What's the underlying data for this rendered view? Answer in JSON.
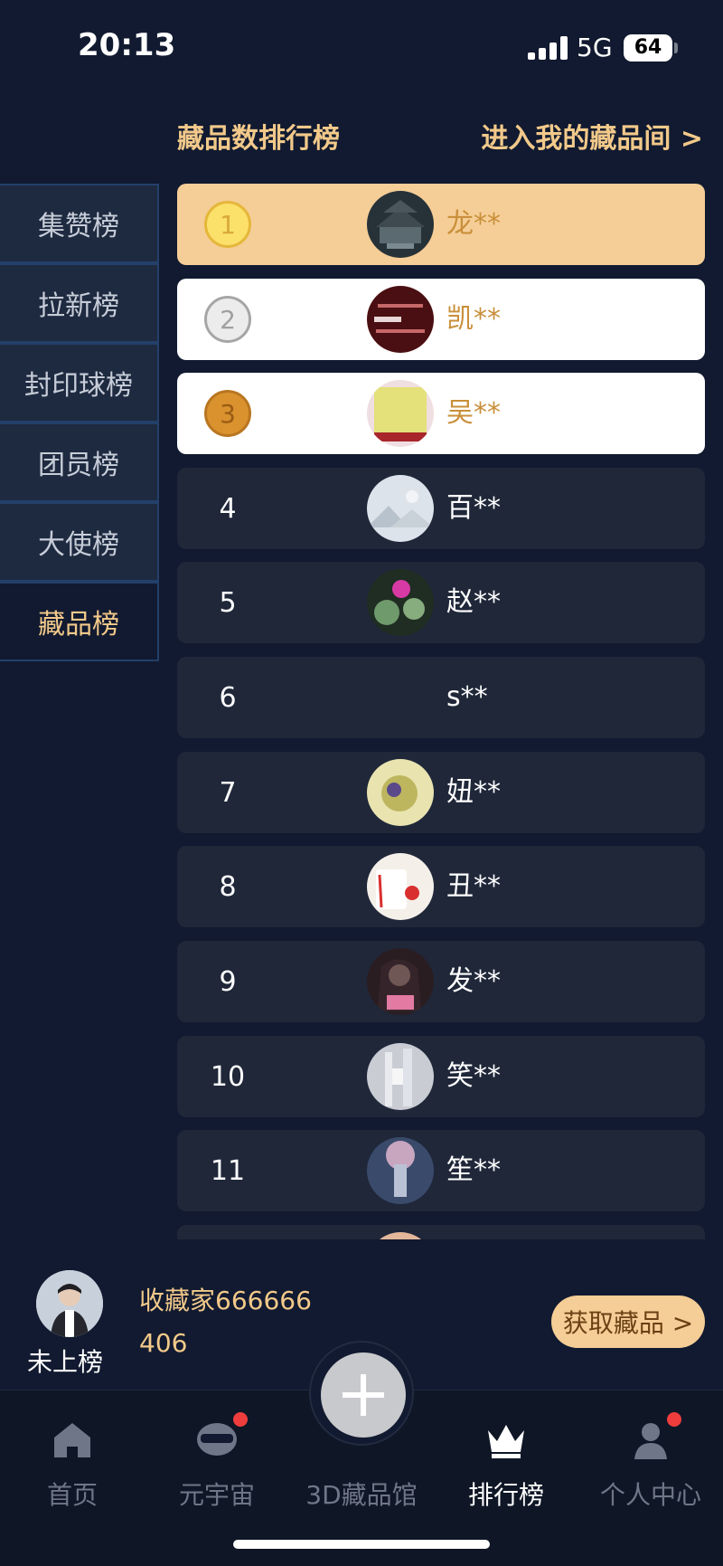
{
  "status_bar": {
    "time": "20:13",
    "network": "5G",
    "battery": "64"
  },
  "header": {
    "title": "藏品数排行榜",
    "enter_link": "进入我的藏品间 >"
  },
  "side_tabs": [
    {
      "label": "集赞榜"
    },
    {
      "label": "拉新榜"
    },
    {
      "label": "封印球榜"
    },
    {
      "label": "团员榜"
    },
    {
      "label": "大使榜"
    },
    {
      "label": "藏品榜",
      "active": true
    }
  ],
  "ranking": [
    {
      "rank": "1",
      "name": "龙**"
    },
    {
      "rank": "2",
      "name": "凯**"
    },
    {
      "rank": "3",
      "name": "吴**"
    },
    {
      "rank": "4",
      "name": "百**"
    },
    {
      "rank": "5",
      "name": "赵**"
    },
    {
      "rank": "6",
      "name": "s**"
    },
    {
      "rank": "7",
      "name": "妞**"
    },
    {
      "rank": "8",
      "name": "丑**"
    },
    {
      "rank": "9",
      "name": "发**"
    },
    {
      "rank": "10",
      "name": "笑**"
    },
    {
      "rank": "11",
      "name": "笙**"
    }
  ],
  "my_info": {
    "rank_status": "未上榜",
    "name": "收藏家666666",
    "count": "406",
    "get_button": "获取藏品 >"
  },
  "tab_bar": [
    {
      "label": "首页",
      "icon": "home-icon"
    },
    {
      "label": "元宇宙",
      "icon": "vr-headset-icon",
      "badge": true
    },
    {
      "label": "3D藏品馆",
      "icon": "plus-icon"
    },
    {
      "label": "排行榜",
      "icon": "crown-icon",
      "active": true
    },
    {
      "label": "个人中心",
      "icon": "person-icon",
      "badge": true
    }
  ],
  "colors": {
    "accent": "#f2c98a",
    "background": "#111a30",
    "row": "#1f2739",
    "gold_row": "#f5cd96",
    "badge": "#ef3d3d"
  }
}
